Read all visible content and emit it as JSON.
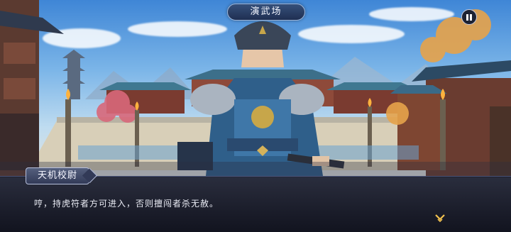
{
  "hud": {
    "location_title": "演武场",
    "pause_icon": "pause-icon"
  },
  "dialog": {
    "speaker": "天机校尉",
    "text": "哼，持虎符者方可进入，否则擅闯者杀无赦。",
    "continue_icon": "chevron-down-icon"
  },
  "colors": {
    "panel": "#161a2a",
    "accent": "#f2c14e",
    "plate": "#2a3e66"
  }
}
